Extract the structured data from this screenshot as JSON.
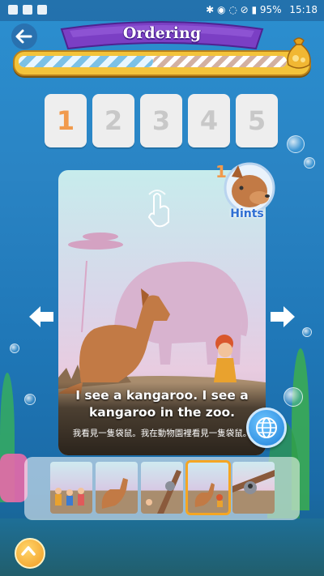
{
  "status_bar": {
    "battery": "95%",
    "time": "15:18"
  },
  "header": {
    "title": "Ordering"
  },
  "progress": {
    "fraction": 0.5
  },
  "steps": [
    {
      "label": "1",
      "active": true
    },
    {
      "label": "2",
      "active": false
    },
    {
      "label": "3",
      "active": false
    },
    {
      "label": "4",
      "active": false
    },
    {
      "label": "5",
      "active": false
    }
  ],
  "card": {
    "caption_en": "I see a kangaroo. I see a kangaroo in the zoo.",
    "caption_zh": "我看見一隻袋鼠。我在動物園裡看見一隻袋鼠。"
  },
  "hints": {
    "label": "Hints",
    "badge": "1"
  },
  "thumbnails": [
    {
      "scene": "group-scene",
      "selected": false
    },
    {
      "scene": "kangaroo-scene",
      "selected": false
    },
    {
      "scene": "koala-tree-scene",
      "selected": false
    },
    {
      "scene": "kangaroo-small-scene",
      "selected": true
    },
    {
      "scene": "koala-branch-scene",
      "selected": false
    }
  ],
  "colors": {
    "accent": "#f5a623",
    "banner": "#7b3fc4",
    "sea": "#2a84c4"
  }
}
